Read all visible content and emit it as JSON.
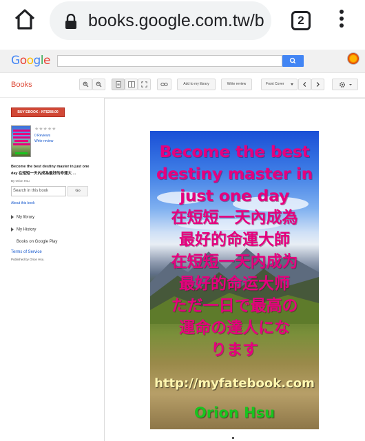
{
  "browser": {
    "url": "books.google.com.tw/b",
    "tab_count": "2",
    "home_icon": "home-icon",
    "lock_icon": "lock-icon",
    "menu_icon": "more-vert-icon"
  },
  "gbar": {
    "logo": "Google",
    "search_value": "",
    "search_icon": "search-icon",
    "colors": {
      "blue": "#4285f4",
      "red": "#ea4335",
      "yellow": "#fbbc05",
      "green": "#34a853"
    }
  },
  "toolbar": {
    "title": "Books",
    "zoom_in_icon": "zoom-in-icon",
    "zoom_out_icon": "zoom-out-icon",
    "single_page_icon": "single-page-icon",
    "two_page_icon": "two-page-icon",
    "fullscreen_icon": "fullscreen-icon",
    "link_icon": "link-icon",
    "add_to_library": "Add to my library",
    "write_review": "Write review",
    "front_cover": "Front Cover",
    "prev_icon": "chevron-left-icon",
    "next_icon": "chevron-right-icon",
    "settings_icon": "gear-icon",
    "accent": "#dd4b39"
  },
  "sidebar": {
    "buy_label": "BUY EBOOK - NT$288.00",
    "stars": "★★★★★",
    "reviews": "0 Reviews",
    "write_review": "Write review",
    "book_title": "Become the best destiny master in just one day 在短短一天內成為最好的命運大 ...",
    "author": "By Orion Hsu",
    "search_placeholder": "Search in this book",
    "go_label": "Go",
    "about": "About this book",
    "my_library": "My library",
    "my_history": "My History",
    "books_on_play": "Books on Google Play",
    "terms": "Terms of Service",
    "published": "Published by Orion Hsu."
  },
  "cover": {
    "line1": "Become the best",
    "line2": "destiny master in",
    "line3": "just one day",
    "line4": "在短短一天內成為",
    "line5": "最好的命運大師",
    "line6": "在短短一天内成为",
    "line7": "最好的命运大师",
    "line8": "ただ一日で最高の",
    "line9": "運命の達人にな",
    "line10": "ります",
    "url": "http://myfatebook.com",
    "author": "Orion Hsu",
    "title_color": "#e6007e",
    "author_color": "#19c41f"
  }
}
